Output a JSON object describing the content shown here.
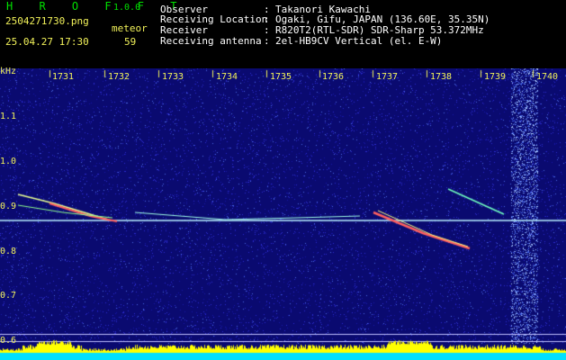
{
  "app": {
    "title": "H R O F F T",
    "version": "1.0.0"
  },
  "file": {
    "name": "2504271730.png",
    "datetime": "25.04.27 17:30"
  },
  "meteor": {
    "label": "meteor",
    "count": "59"
  },
  "info": [
    {
      "key": "Observer",
      "sep": ":",
      "value": "Takanori Kawachi"
    },
    {
      "key": "Receiving Location",
      "sep": ":",
      "value": "Ogaki, Gifu, JAPAN (136.60E, 35.35N)"
    },
    {
      "key": "Receiver",
      "sep": ":",
      "value": "R820T2(RTL-SDR) SDR-Sharp 53.372MHz"
    },
    {
      "key": "Receiving antenna",
      "sep": ":",
      "value": "2el-HB9CV Vertical (el. E-W)"
    }
  ],
  "axis": {
    "unit": "kHz",
    "freq_labels": [
      "1.1",
      "1.0",
      "0.9",
      "0.8",
      "0.7",
      "0.6"
    ],
    "time_labels": [
      "1731",
      "1732",
      "1733",
      "1734",
      "1735",
      "1736",
      "1737",
      "1738",
      "1739",
      "1740"
    ]
  },
  "colors": {
    "background": "#000000",
    "spectrum_base": "#1a1aa0",
    "header_green": "#00e000",
    "header_yellow": "#f2f25a",
    "carrier": "#c8ffff",
    "power_bar": "#ffff00",
    "power_base": "#00e0ff"
  }
}
